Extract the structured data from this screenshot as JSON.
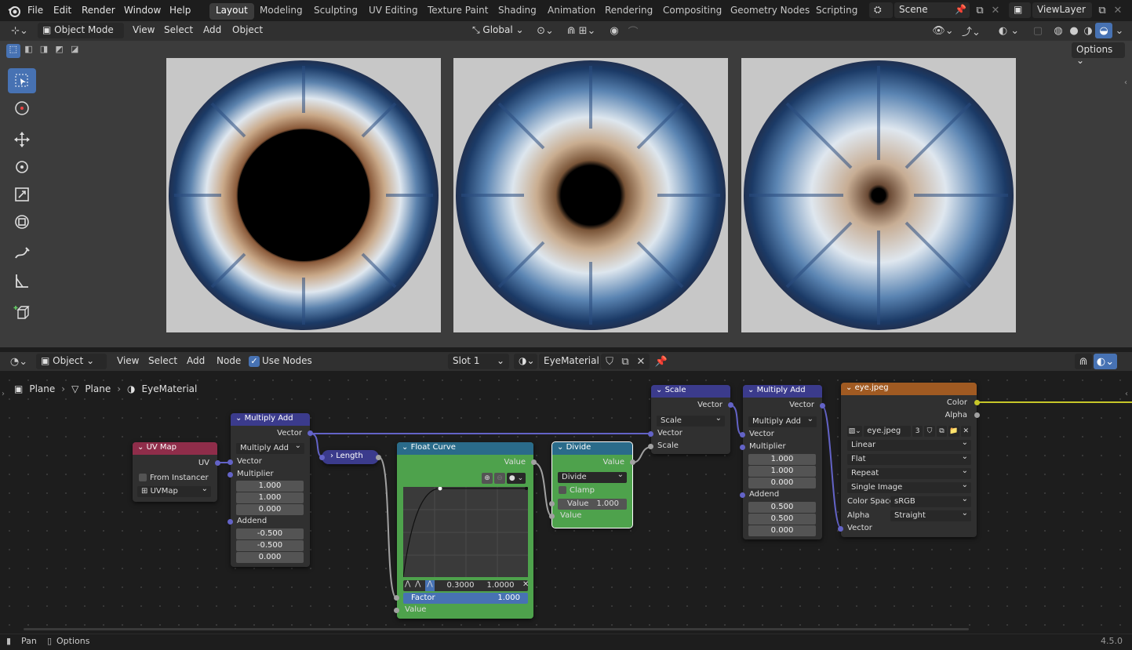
{
  "menu": {
    "file": "File",
    "edit": "Edit",
    "render": "Render",
    "window": "Window",
    "help": "Help"
  },
  "workspaces": [
    "Layout",
    "Modeling",
    "Sculpting",
    "UV Editing",
    "Texture Paint",
    "Shading",
    "Animation",
    "Rendering",
    "Compositing",
    "Geometry Nodes",
    "Scripting"
  ],
  "scene": {
    "label": "Scene",
    "view_layer": "ViewLayer"
  },
  "viewport": {
    "mode": "Object Mode",
    "view": "View",
    "select": "Select",
    "add": "Add",
    "object": "Object",
    "transform_orientation": "Global",
    "options": "Options"
  },
  "node_editor": {
    "type": "Object",
    "view": "View",
    "select": "Select",
    "add": "Add",
    "node": "Node",
    "use_nodes": "Use Nodes",
    "slot": "Slot 1",
    "material": "EyeMaterial",
    "breadcrumb": [
      "Plane",
      "Plane",
      "EyeMaterial"
    ]
  },
  "nodes": {
    "uvmap": {
      "title": "UV Map",
      "out": "UV",
      "from_instancer": "From Instancer",
      "map": "UVMap"
    },
    "muladd1": {
      "title": "Multiply Add",
      "out": "Vector",
      "op": "Multiply Add",
      "in_vector": "Vector",
      "mult_label": "Multiplier",
      "mult": [
        "1.000",
        "1.000",
        "0.000"
      ],
      "addend_label": "Addend",
      "addend": [
        "-0.500",
        "-0.500",
        "0.000"
      ]
    },
    "length": {
      "title": "Length"
    },
    "floatcurve": {
      "title": "Float Curve",
      "out": "Value",
      "cx": "0.3000",
      "cy": "1.0000",
      "factor_label": "Factor",
      "factor": "1.000",
      "in_value": "Value"
    },
    "divide": {
      "title": "Divide",
      "out": "Value",
      "op": "Divide",
      "clamp": "Clamp",
      "value_label": "Value",
      "value": "1.000",
      "in_value": "Value"
    },
    "scale": {
      "title": "Scale",
      "out": "Vector",
      "op": "Scale",
      "in_vector": "Vector",
      "in_scale": "Scale"
    },
    "muladd2": {
      "title": "Multiply Add",
      "out": "Vector",
      "op": "Multiply Add",
      "in_vector": "Vector",
      "mult_label": "Multiplier",
      "mult": [
        "1.000",
        "1.000",
        "0.000"
      ],
      "addend_label": "Addend",
      "addend": [
        "0.500",
        "0.500",
        "0.000"
      ]
    },
    "image": {
      "title": "eye.jpeg",
      "out_color": "Color",
      "out_alpha": "Alpha",
      "image_name": "eye.jpeg",
      "users": "3",
      "interp": "Linear",
      "proj": "Flat",
      "ext": "Repeat",
      "source": "Single Image",
      "cs_label": "Color Space",
      "cs": "sRGB",
      "alpha_label": "Alpha",
      "alpha": "Straight",
      "in_vector": "Vector"
    }
  },
  "status": {
    "pan": "Pan",
    "options": "Options",
    "version": "4.5.0"
  },
  "colors": {
    "accent": "#4772b3",
    "vector_socket": "#6363c7",
    "color_socket": "#c7c729",
    "converter": "#2a6b8a",
    "vector_node": "#3b3b8c",
    "input_node": "#8f2d4a",
    "texture_node": "#a05a22",
    "float_curve_body": "#4ea24c"
  }
}
